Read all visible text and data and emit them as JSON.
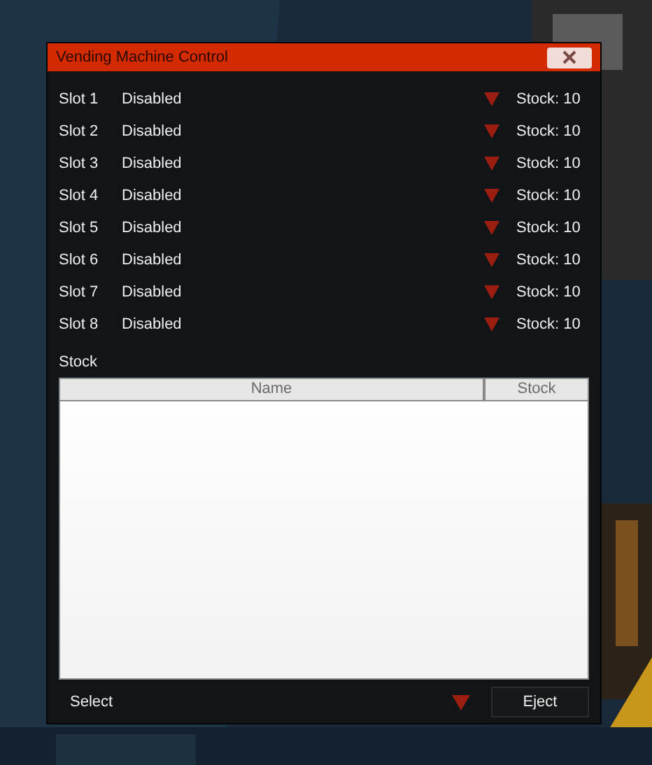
{
  "window": {
    "title": "Vending Machine Control"
  },
  "slots": [
    {
      "label": "Slot 1",
      "status": "Disabled",
      "stock": "Stock: 10"
    },
    {
      "label": "Slot 2",
      "status": "Disabled",
      "stock": "Stock: 10"
    },
    {
      "label": "Slot 3",
      "status": "Disabled",
      "stock": "Stock: 10"
    },
    {
      "label": "Slot 4",
      "status": "Disabled",
      "stock": "Stock: 10"
    },
    {
      "label": "Slot 5",
      "status": "Disabled",
      "stock": "Stock: 10"
    },
    {
      "label": "Slot 6",
      "status": "Disabled",
      "stock": "Stock: 10"
    },
    {
      "label": "Slot 7",
      "status": "Disabled",
      "stock": "Stock: 10"
    },
    {
      "label": "Slot 8",
      "status": "Disabled",
      "stock": "Stock: 10"
    }
  ],
  "stock_section": {
    "label": "Stock",
    "table": {
      "columns": [
        "Name",
        "Stock"
      ]
    }
  },
  "footer": {
    "select": "Select",
    "eject_button": "Eject"
  }
}
